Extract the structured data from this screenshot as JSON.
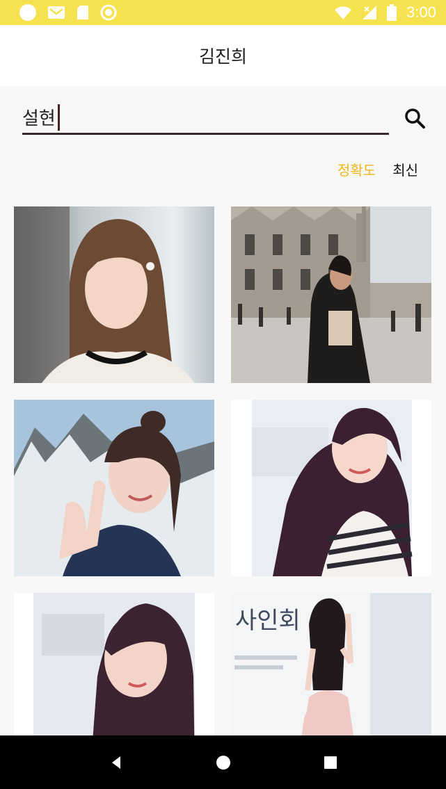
{
  "status_bar": {
    "time": "3:00",
    "icons_left": [
      "circle-icon",
      "mail-icon",
      "sd-card-icon",
      "circle-outline-icon"
    ],
    "icons_right": [
      "wifi-icon",
      "signal-icon",
      "battery-icon"
    ],
    "background": "#f6e24e"
  },
  "app_bar": {
    "title": "김진희"
  },
  "search": {
    "value": "설현",
    "search_icon": "search-icon"
  },
  "sort": {
    "options": [
      "정확도",
      "최신"
    ],
    "active": "정확도",
    "active_color": "#f2b61a"
  },
  "results": [
    {
      "name": "photo-1"
    },
    {
      "name": "photo-2"
    },
    {
      "name": "photo-3"
    },
    {
      "name": "photo-4"
    },
    {
      "name": "photo-5"
    },
    {
      "name": "photo-6",
      "overlay_text": "사인회"
    }
  ],
  "nav_bar": {
    "buttons": [
      "back-icon",
      "home-icon",
      "recents-icon"
    ]
  }
}
